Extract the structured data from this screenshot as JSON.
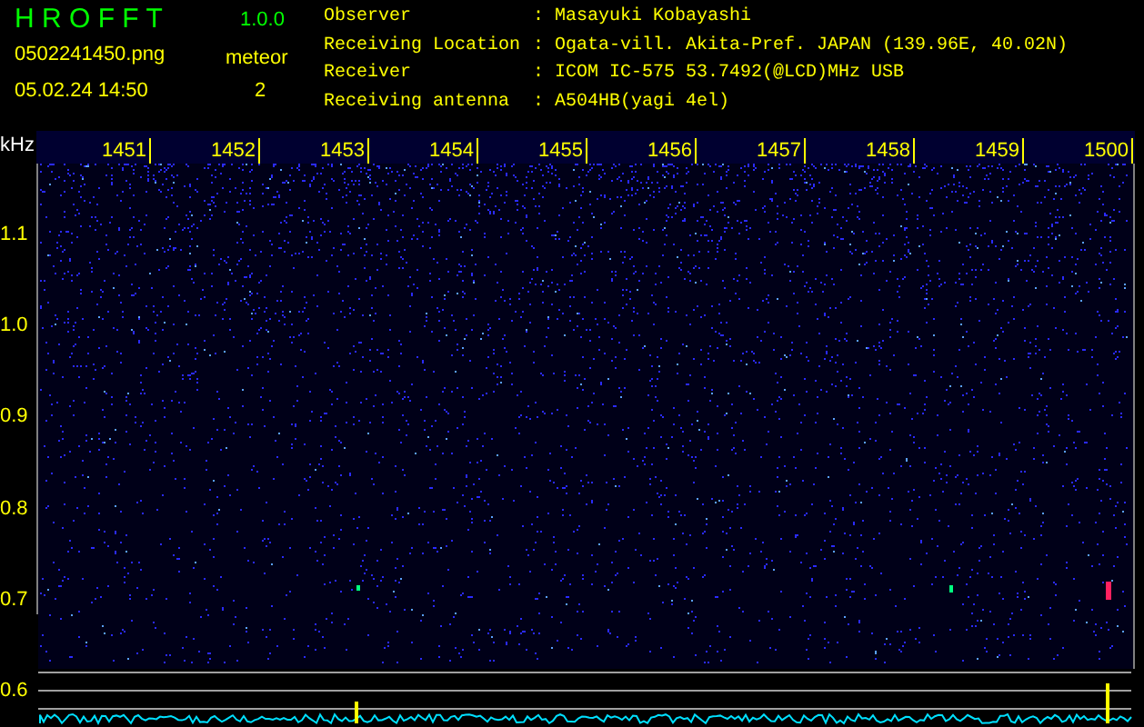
{
  "app": {
    "title": "H R O F F T",
    "version": "1.0.0"
  },
  "file": {
    "name": "0502241450.png",
    "datetime": "05.02.24 14:50"
  },
  "meteor": {
    "label": "meteor",
    "count": "2"
  },
  "info": [
    {
      "label": "Observer",
      "sep": ":",
      "value": "Masayuki Kobayashi"
    },
    {
      "label": "Receiving Location",
      "sep": ":",
      "value": "Ogata-vill. Akita-Pref. JAPAN (139.96E, 40.02N)"
    },
    {
      "label": "Receiver",
      "sep": ":",
      "value": "ICOM IC-575 53.7492(@LCD)MHz USB"
    },
    {
      "label": "Receiving antenna",
      "sep": ":",
      "value": "A504HB(yagi 4el)"
    }
  ],
  "spectrogram": {
    "unit": "kHz",
    "time_labels": [
      "1451",
      "1452",
      "1453",
      "1454",
      "1455",
      "1456",
      "1457",
      "1458",
      "1459",
      "1500"
    ],
    "freq_labels": [
      "1.1",
      "1.0",
      "0.9",
      "0.8",
      "0.7",
      "0.6"
    ]
  }
}
